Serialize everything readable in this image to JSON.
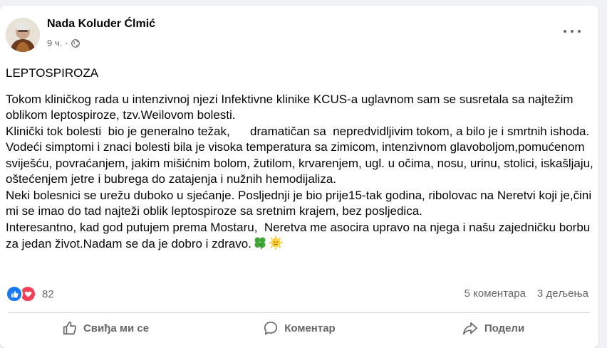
{
  "post": {
    "author": "Nada Koluder Ćlmić",
    "time": "9 ч.",
    "privacy_icon": "globe-icon",
    "title": "LEPTOSPIROZA",
    "paragraph1": "Tokom kliničkog rada u intenzivnoj njezi Infektivne klinike KCUS-a uglavnom sam se susretala sa najtežim oblikom leptospiroze, tzv.Weilovom bolesti.",
    "paragraph2": "Klinički tok bolesti  bio je generalno težak,      dramatičan sa  nepredvidljivim tokom, a bilo je i smrtnih ishoda.",
    "paragraph3": "Vodeći simptomi i znaci bolesti bila je visoka temperatura sa zimicom, intenzivnom glavoboljom,pomućenom sviješću, povraćanjem, jakim mišićnim bolom, žutilom, krvarenjem, ugl. u očima, nosu, urinu, stolici, iskašljaju, oštećenjem jetre i bubrega do zatajenja i nužnih hemodijaliza.",
    "paragraph4": "Neki bolesnici se urežu duboko u sjećanje. Posljednji je bio prije15-tak godina, ribolovac na Neretvi koji je,čini mi se imao do tad najteži oblik leptospiroze sa sretnim krajem, bez posljedica.",
    "paragraph5": "Interesantno, kad god putujem prema Mostaru,  Neretva me asocira upravo na njega i našu zajedničku borbu za jedan život.Nadam se da je dobro i zdravo."
  },
  "reactions": {
    "count": "82",
    "comments": "5 коментара",
    "shares": "3 дељења"
  },
  "actions": {
    "like": "Свиђа ми се",
    "comment": "Коментар",
    "share": "Подели"
  }
}
